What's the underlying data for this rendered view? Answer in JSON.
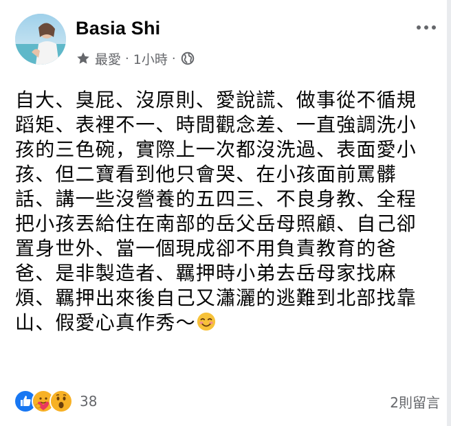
{
  "post": {
    "author": "Basia Shi",
    "meta": {
      "audience_icon": "star-icon",
      "category": "最愛",
      "separator": "·",
      "time": "1小時",
      "privacy_icon": "globe-icon"
    },
    "more_icon": "more-options-icon",
    "text": "自大、臭屁、沒原則、愛說謊、做事從不循規\n蹈矩、表裡不一、時間觀念差、一直強調洗小\n孩的三色碗，實際上一次都沒洗過、表面愛小\n孩、但二寶看到他只會哭、在小孩面前罵髒\n話、講一些沒營養的五四三、不良身教、全程\n把小孩丟給住在南部的岳父岳母照顧、自己卻\n置身世外、當一個現成卻不用負責教育的爸\n爸、是非製造者、羈押時小弟去岳母家找麻\n煩、羈押出來後自己又瀟灑的逃難到北部找靠\n山、假愛心真作秀～",
    "emoji": "smiling-face-icon",
    "reactions": {
      "icons": [
        "like-icon",
        "care-icon",
        "wow-icon"
      ],
      "count": "38"
    },
    "comments": "2則留言"
  },
  "colors": {
    "text": "#050505",
    "secondary": "#65676b",
    "like_blue": "#1877f2",
    "care_yellow": "#f7b125",
    "wow_yellow": "#f7b125"
  }
}
